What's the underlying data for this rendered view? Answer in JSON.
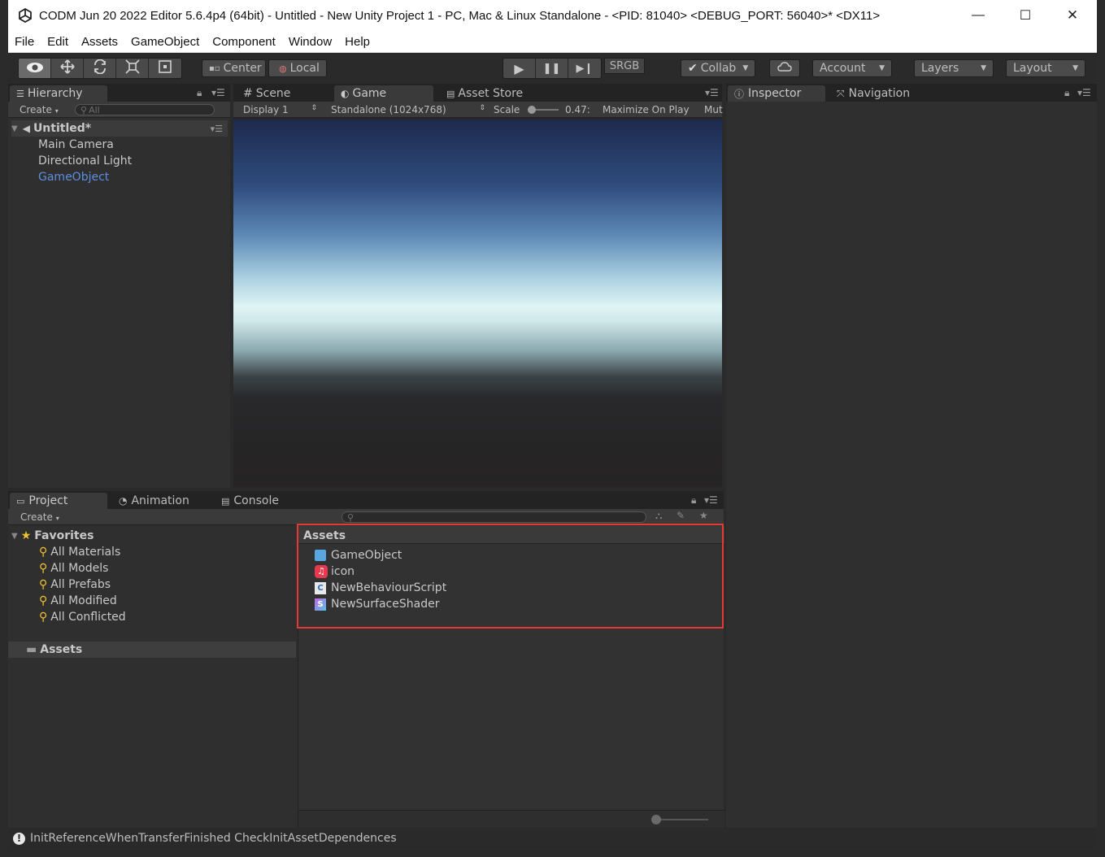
{
  "window": {
    "title": "CODM Jun 20 2022 Editor 5.6.4p4 (64bit) - Untitled - New Unity Project 1 - PC, Mac & Linux Standalone - <PID: 81040> <DEBUG_PORT: 56040>* <DX11>",
    "minimize": "—",
    "maximize": "☐",
    "close": "✕"
  },
  "menu": [
    "File",
    "Edit",
    "Assets",
    "GameObject",
    "Component",
    "Window",
    "Help"
  ],
  "toolbar": {
    "tools": [
      "view-tool",
      "move-tool",
      "rotate-tool",
      "scale-tool",
      "rect-tool"
    ],
    "pivot_center": "Center",
    "pivot_local": "Local",
    "play": "▶",
    "pause": "❚❚",
    "step": "▶❙",
    "srgb": "SRGB",
    "collab": "Collab",
    "account": "Account",
    "layers": "Layers",
    "layout": "Layout"
  },
  "hierarchy": {
    "tab": "Hierarchy",
    "create": "Create",
    "search_placeholder": "All",
    "scene": "Untitled*",
    "items": [
      "Main Camera",
      "Directional Light",
      "GameObject"
    ]
  },
  "center_tabs": {
    "scene": "Scene",
    "game": "Game",
    "asset_store": "Asset Store"
  },
  "game_toolbar": {
    "display": "Display 1",
    "resolution": "Standalone (1024x768)",
    "scale_label": "Scale",
    "scale_value": "0.47:",
    "maximize": "Maximize On Play",
    "mute": "Mut"
  },
  "inspector": {
    "tab": "Inspector",
    "navigation_tab": "Navigation"
  },
  "bottom_tabs": {
    "project": "Project",
    "animation": "Animation",
    "console": "Console"
  },
  "project": {
    "create": "Create",
    "favorites_label": "Favorites",
    "favorites": [
      "All Materials",
      "All Models",
      "All Prefabs",
      "All Modified",
      "All Conflicted"
    ],
    "assets_folder": "Assets",
    "breadcrumb": "Assets",
    "assets": [
      {
        "name": "GameObject",
        "icon": "prefab-icon"
      },
      {
        "name": "icon",
        "icon": "image-icon"
      },
      {
        "name": "NewBehaviourScript",
        "icon": "csharp-script-icon"
      },
      {
        "name": "NewSurfaceShader",
        "icon": "shader-icon"
      }
    ]
  },
  "status": {
    "message": "InitReferenceWhenTransferFinished CheckInitAssetDependences"
  }
}
